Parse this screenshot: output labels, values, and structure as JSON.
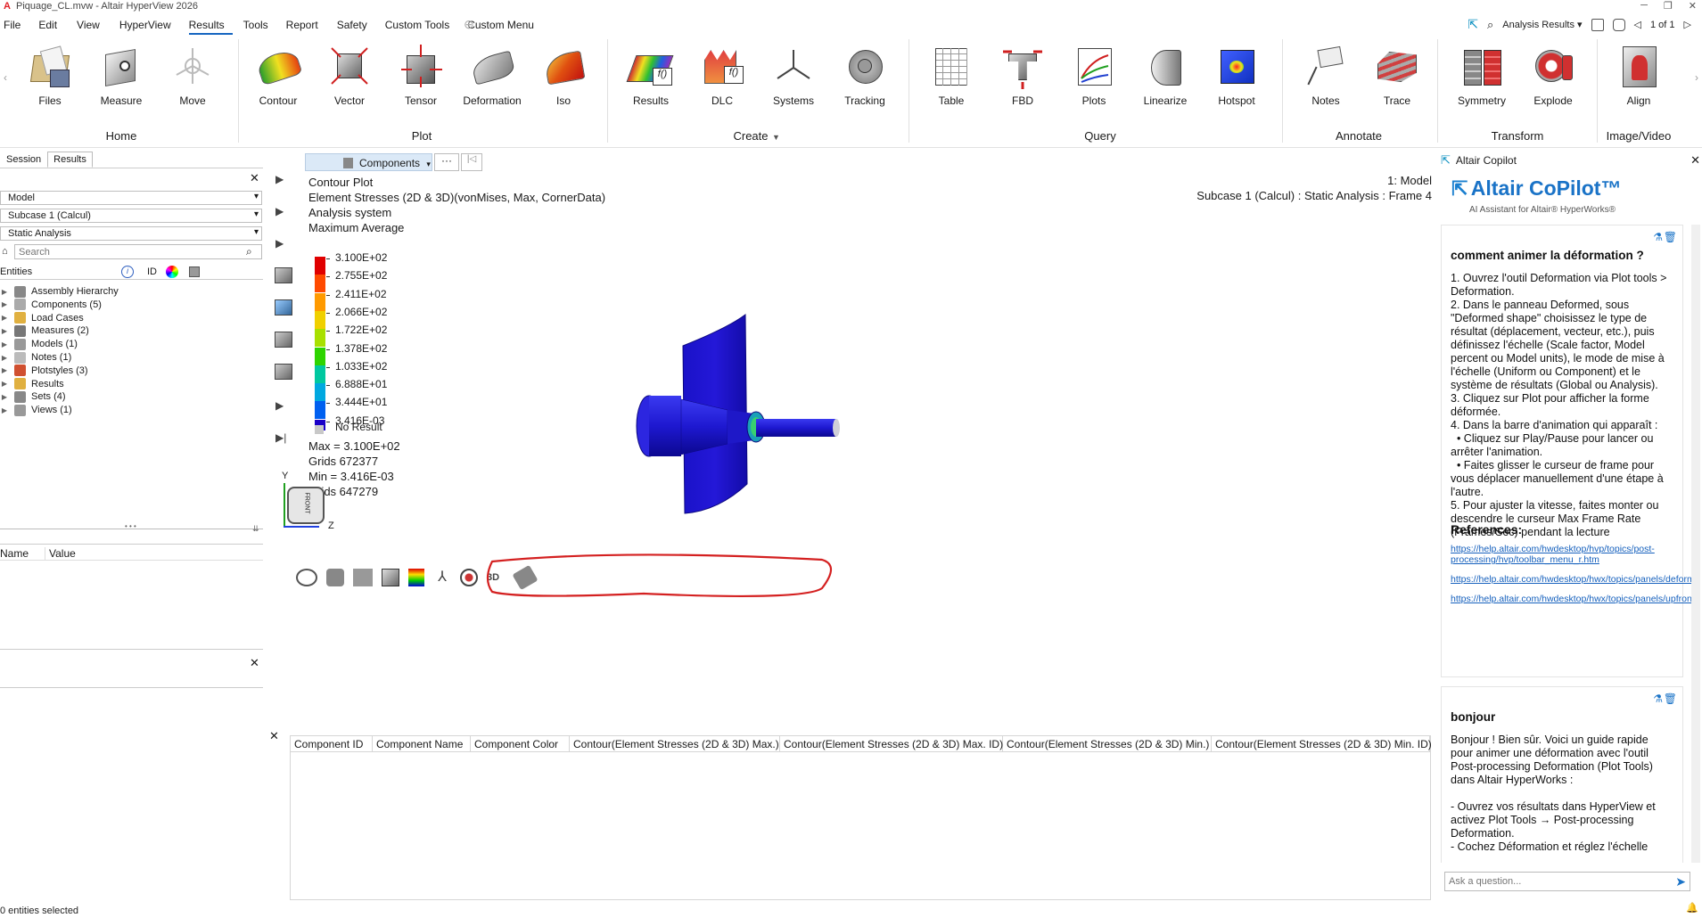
{
  "window": {
    "title": "Piquage_CL.mvw - Altair HyperView 2026"
  },
  "menu": {
    "items": [
      "File",
      "Edit",
      "View",
      "HyperView",
      "Results",
      "Tools",
      "Report",
      "Safety",
      "Custom Tools",
      "Custom Menu"
    ],
    "active": "Results"
  },
  "toolbar_right": {
    "analysis_results": "Analysis Results",
    "pager": "1 of 1"
  },
  "ribbon": {
    "tools": {
      "files": "Files",
      "measure": "Measure",
      "move": "Move",
      "contour": "Contour",
      "vector": "Vector",
      "tensor": "Tensor",
      "deformation": "Deformation",
      "iso": "Iso",
      "results": "Results",
      "dlc": "DLC",
      "systems": "Systems",
      "tracking": "Tracking",
      "table": "Table",
      "fbd": "FBD",
      "plots": "Plots",
      "linearize": "Linearize",
      "hotspot": "Hotspot",
      "notes": "Notes",
      "trace": "Trace",
      "symmetry": "Symmetry",
      "explode": "Explode",
      "align": "Align"
    },
    "groups": {
      "home": "Home",
      "plot": "Plot",
      "create": "Create",
      "query": "Query",
      "annotate": "Annotate",
      "transform": "Transform",
      "image_video": "Image/Video"
    }
  },
  "left_panel": {
    "tabs": [
      "Session",
      "Results"
    ],
    "active_tab": "Results",
    "model_select": "Model",
    "subcase_select": "Subcase 1 (Calcul)",
    "analysis_select": "Static Analysis",
    "search_placeholder": "Search",
    "entities_header": "Entities",
    "id_header": "ID",
    "tree": [
      "Assembly Hierarchy",
      "Components (5)",
      "Load Cases",
      "Measures (2)",
      "Models (1)",
      "Notes (1)",
      "Plotstyles (3)",
      "Results",
      "Sets (4)",
      "Views (1)"
    ],
    "props_name": "Name",
    "props_value": "Value"
  },
  "viewport": {
    "components_dropdown": "Components",
    "components_more": "···",
    "plot_info": {
      "line1": "Contour Plot",
      "line2": "Element Stresses (2D & 3D)(vonMises, Max, CornerData)",
      "line3": "Analysis system",
      "line4": "Maximum Average"
    },
    "legend": {
      "values": [
        "3.100E+02",
        "2.755E+02",
        "2.411E+02",
        "2.066E+02",
        "1.722E+02",
        "1.378E+02",
        "1.033E+02",
        "6.888E+01",
        "3.444E+01",
        "3.416E-03"
      ],
      "colors": [
        "#e00000",
        "#ff4a00",
        "#ff9a00",
        "#f0d000",
        "#a8e000",
        "#2ed400",
        "#00c8a0",
        "#00a8e0",
        "#0060f0",
        "#1a00c8"
      ],
      "no_result": "No Result",
      "no_result_color": "#c8c8c8"
    },
    "stats": {
      "max": "Max = 3.100E+02",
      "max_grid": "Grids 672377",
      "min": "Min = 3.416E-03",
      "min_grid": "Grids 647279"
    },
    "model_label": "1: Model",
    "subcase_label": "Subcase 1 (Calcul) : Static Analysis : Frame 4",
    "axes": {
      "y": "Y",
      "z": "Z",
      "cube_face": "FRONT"
    }
  },
  "table": {
    "headers": [
      "Component ID",
      "Component Name",
      "Component Color",
      "Contour(Element Stresses (2D & 3D) Max.)",
      "Contour(Element Stresses (2D & 3D) Max. ID)",
      "Contour(Element Stresses (2D & 3D) Min.)",
      "Contour(Element Stresses (2D & 3D) Min. ID)"
    ]
  },
  "copilot": {
    "panel_title": "Altair Copilot",
    "brand": "Altair CoPilot™",
    "tagline": "AI Assistant for Altair® HyperWorks®",
    "q1": "comment animer la déformation ?",
    "a1": [
      "1. Ouvrez l'outil Deformation via Plot tools > Deformation.",
      "2. Dans le panneau Deformed, sous \"Deformed shape\" choisissez le type de résultat (déplacement, vecteur, etc.), puis définissez l'échelle (Scale factor, Model percent ou Model units), le mode de mise à l'échelle (Uniform ou Component) et le système de résultats (Global ou Analysis).",
      "3. Cliquez sur Plot pour afficher la forme déformée.",
      "4. Dans la barre d'animation qui apparaît :",
      "  • Cliquez sur Play/Pause pour lancer ou arrêter l'animation.",
      "  • Faites glisser le curseur de frame pour vous déplacer manuellement d'une étape à l'autre.",
      "5. Pour ajuster la vitesse, faites monter ou descendre le curseur Max Frame Rate (Frames/Sec) pendant la lecture"
    ],
    "refs_title": "References:",
    "refs": [
      "https://help.altair.com/hwdesktop/hvp/topics/post-processing/hvp/toolbar_menu_r.htm",
      "https://help.altair.com/hwdesktop/hwx/topics/panels/deformed_panel_r.htm",
      "https://help.altair.com/hwdesktop/hwx/topics/panels/upfront_loader_visualizing_results_hvx_r.htm"
    ],
    "q2": "bonjour",
    "a2": [
      "Bonjour ! Bien sûr. Voici un guide rapide pour animer une déformation avec l'outil Post-processing Deformation (Plot Tools) dans Altair HyperWorks :",
      "",
      "- Ouvrez vos résultats dans HyperView et activez Plot Tools → Post-processing Deformation.",
      "- Cochez Déformation et réglez l'échelle"
    ],
    "ask_placeholder": "Ask a question..."
  },
  "status": {
    "selected": "0 entities selected"
  }
}
